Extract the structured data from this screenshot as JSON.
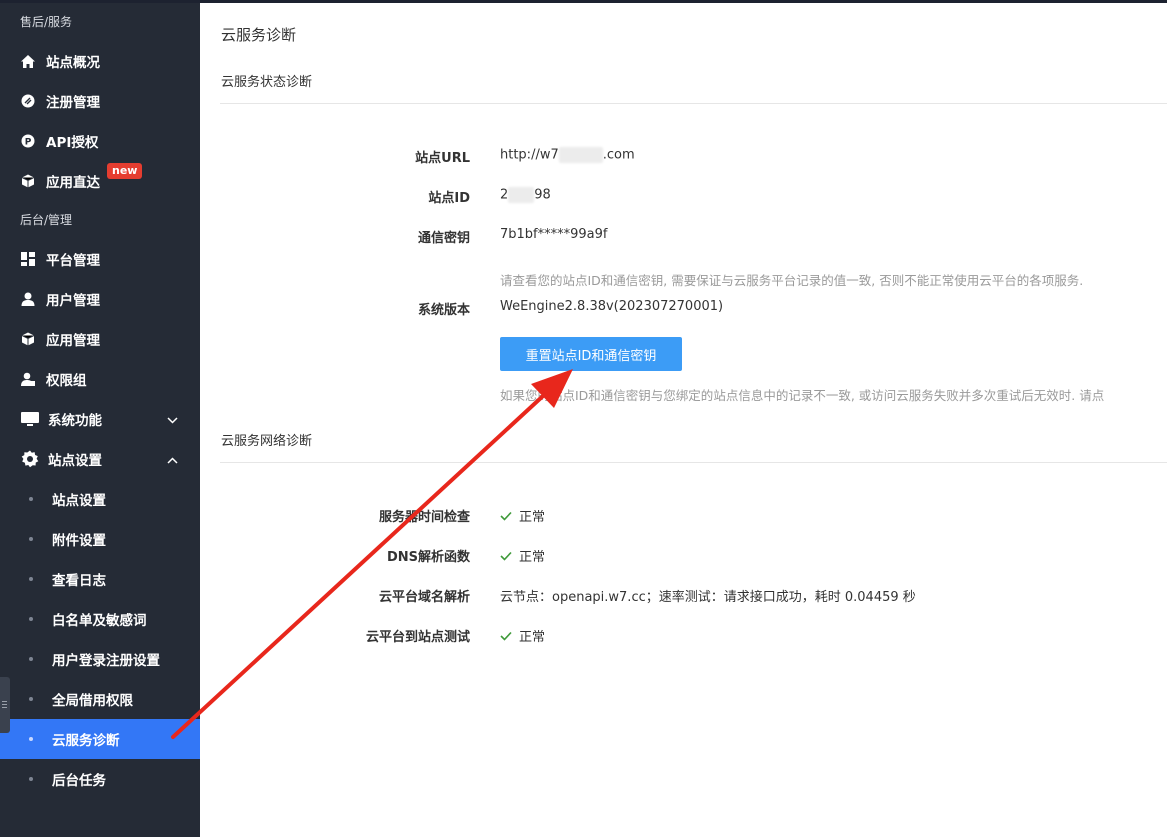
{
  "sidebar": {
    "section1_title": "售后/服务",
    "section2_title": "后台/管理",
    "items": [
      {
        "label": "站点概况",
        "icon": "home-icon"
      },
      {
        "label": "注册管理",
        "icon": "register-icon"
      },
      {
        "label": "API授权",
        "icon": "api-icon"
      },
      {
        "label": "应用直达",
        "icon": "cube-icon",
        "badge": "new"
      },
      {
        "label": "平台管理",
        "icon": "grid-icon"
      },
      {
        "label": "用户管理",
        "icon": "user-icon"
      },
      {
        "label": "应用管理",
        "icon": "box-icon"
      },
      {
        "label": "权限组",
        "icon": "user-group-icon"
      },
      {
        "label": "系统功能",
        "icon": "monitor-icon"
      },
      {
        "label": "站点设置",
        "icon": "gear-icon"
      }
    ],
    "sub_items": [
      {
        "label": "站点设置"
      },
      {
        "label": "附件设置"
      },
      {
        "label": "查看日志"
      },
      {
        "label": "白名单及敏感词"
      },
      {
        "label": "用户登录注册设置"
      },
      {
        "label": "全局借用权限"
      },
      {
        "label": "云服务诊断",
        "active": true
      },
      {
        "label": "后台任务"
      }
    ]
  },
  "main": {
    "page_title": "云服务诊断",
    "status_section": {
      "title": "云服务状态诊断",
      "site_url_label": "站点URL",
      "site_url_prefix": "http://w7",
      "site_url_suffix": ".com",
      "site_id_label": "站点ID",
      "site_id_prefix": "2",
      "site_id_suffix": "98",
      "secret_label": "通信密钥",
      "secret_value": "7b1bf*****99a9f",
      "secret_help": "请查看您的站点ID和通信密钥, 需要保证与云服务平台记录的值一致, 否则不能正常使用云平台的各项服务.",
      "version_label": "系统版本",
      "version_value": "WeEngine2.8.38v(202307270001)",
      "reset_button": "重置站点ID和通信密钥",
      "reset_help": "如果您的站点ID和通信密钥与您绑定的站点信息中的记录不一致, 或访问云服务失败并多次重试后无效时. 请点"
    },
    "network_section": {
      "title": "云服务网络诊断",
      "rows": [
        {
          "label": "服务器时间检查",
          "value": "正常",
          "ok": true
        },
        {
          "label": "DNS解析函数",
          "value": "正常",
          "ok": true
        },
        {
          "label": "云平台域名解析",
          "value": "云节点：openapi.w7.cc；速率测试：请求接口成功，耗时 0.04459 秒",
          "ok": false
        },
        {
          "label": "云平台到站点测试",
          "value": "正常",
          "ok": true
        }
      ]
    }
  },
  "colors": {
    "sidebar_bg": "#252b36",
    "active_bg": "#3377f6",
    "button_bg": "#3c9cf6",
    "ok_green": "#3f9a3a",
    "annotation_red": "#e8271c",
    "badge_red": "#e53d30"
  }
}
